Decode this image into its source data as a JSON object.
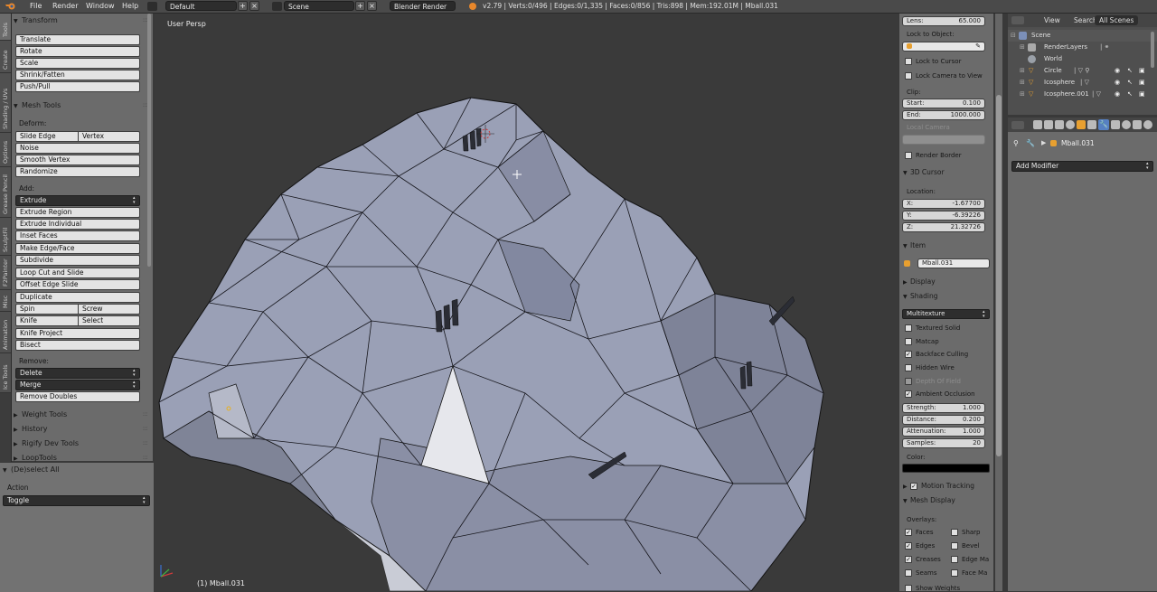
{
  "menubar": {
    "menus": [
      "File",
      "Render",
      "Window",
      "Help"
    ],
    "layout": "Default",
    "scene": "Scene",
    "engine": "Blender Render",
    "stats": "v2.79 | Verts:0/496 | Edges:0/1,335 | Faces:0/856 | Tris:898 | Mem:192.01M | Mball.031"
  },
  "tabs": [
    "Tools",
    "Create",
    "Shading / UVs",
    "Options",
    "Grease Pencil",
    "SculptFil",
    "F2Painter",
    "Misc",
    "Animation",
    "Ice Tools"
  ],
  "toolshelf": {
    "transform": {
      "title": "Transform",
      "buttons": [
        "Translate",
        "Rotate",
        "Scale",
        "Shrink/Fatten",
        "Push/Pull"
      ]
    },
    "mesh_tools": {
      "title": "Mesh Tools",
      "deform_label": "Deform:",
      "slide_edge": "Slide Edge",
      "vertex": "Vertex",
      "noise": "Noise",
      "smooth_vertex": "Smooth Vertex",
      "randomize": "Randomize",
      "add_label": "Add:",
      "extrude": "Extrude",
      "add_buttons": [
        "Extrude Region",
        "Extrude Individual",
        "Inset Faces",
        "Make Edge/Face",
        "Subdivide",
        "Loop Cut and Slide",
        "Offset Edge Slide",
        "Duplicate"
      ],
      "spin": "Spin",
      "screw": "Screw",
      "knife": "Knife",
      "select": "Select",
      "knife_project": "Knife Project",
      "bisect": "Bisect",
      "remove_label": "Remove:",
      "delete": "Delete",
      "merge": "Merge",
      "remove_doubles": "Remove Doubles"
    },
    "collapsed": [
      "Weight Tools",
      "History",
      "Rigify Dev Tools",
      "LoopTools"
    ]
  },
  "operator": {
    "title": "(De)select All",
    "action_label": "Action",
    "action_value": "Toggle"
  },
  "viewport": {
    "view_label": "User Persp",
    "object_label": "(1) Mball.031"
  },
  "npanel": {
    "lens_label": "Lens:",
    "lens_value": "65.000",
    "lock_to_object": "Lock to Object:",
    "lock_to_cursor": "Lock to Cursor",
    "lock_camera": "Lock Camera to View",
    "clip_label": "Clip:",
    "start_label": "Start:",
    "start_value": "0.100",
    "end_label": "End:",
    "end_value": "1000.000",
    "local_camera": "Local Camera",
    "render_border": "Render Border",
    "cursor_title": "3D Cursor",
    "location_label": "Location:",
    "x_label": "X:",
    "x_value": "-1.67700",
    "y_label": "Y:",
    "y_value": "-6.39226",
    "z_label": "Z:",
    "z_value": "21.32726",
    "item_title": "Item",
    "item_name": "Mball.031",
    "display_title": "Display",
    "shading_title": "Shading",
    "shading_mode": "Multitexture",
    "textured_solid": "Textured Solid",
    "matcap": "Matcap",
    "backface_culling": "Backface Culling",
    "hidden_wire": "Hidden Wire",
    "depth_of_field": "Depth Of Field",
    "ambient_occlusion": "Ambient Occlusion",
    "strength_label": "Strength:",
    "strength_value": "1.000",
    "distance_label": "Distance:",
    "distance_value": "0.200",
    "attenuation_label": "Attenuation:",
    "attenuation_value": "1.000",
    "samples_label": "Samples:",
    "samples_value": "20",
    "color_label": "Color:",
    "motion_tracking": "Motion Tracking",
    "mesh_display": "Mesh Display",
    "overlays_label": "Overlays:",
    "faces": "Faces",
    "sharp": "Sharp",
    "edges": "Edges",
    "bevel": "Bevel",
    "creases": "Creases",
    "edge_ma": "Edge Ma",
    "seams": "Seams",
    "face_ma": "Face Ma",
    "show_weights": "Show Weights"
  },
  "outliner": {
    "tabs": [
      "View",
      "Search",
      "All Scenes"
    ],
    "rows": [
      "Scene",
      "RenderLayers",
      "World",
      "Circle",
      "Icosphere",
      "Icosphere.001"
    ]
  },
  "properties": {
    "object_name": "Mball.031",
    "add_modifier": "Add Modifier"
  },
  "colors": {
    "mesh_face": "#9aa0b6",
    "mesh_dark": "#4b4f60",
    "panel": "#6b6b6b",
    "accent_blue": "#5680c2"
  }
}
